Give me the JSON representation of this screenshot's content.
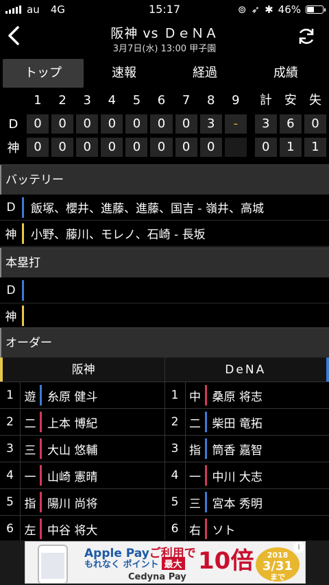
{
  "status_bar": {
    "carrier": "au",
    "network": "4G",
    "time": "15:17",
    "battery": "46%",
    "battery_level": 0.46
  },
  "header": {
    "title": "阪神 vs ＤｅＮＡ",
    "subtitle": "3月7日(水) 13:00 甲子園"
  },
  "tabs": [
    {
      "label": "トップ",
      "active": true
    },
    {
      "label": "速報",
      "active": false
    },
    {
      "label": "経過",
      "active": false
    },
    {
      "label": "成績",
      "active": false
    }
  ],
  "scoreboard": {
    "innings": [
      "1",
      "2",
      "3",
      "4",
      "5",
      "6",
      "7",
      "8",
      "9"
    ],
    "totals_headers": [
      "計",
      "安",
      "失"
    ],
    "teams": [
      {
        "label": "D",
        "innings": [
          "0",
          "0",
          "0",
          "0",
          "0",
          "0",
          "0",
          "3",
          "-"
        ],
        "totals": [
          "3",
          "6",
          "0"
        ]
      },
      {
        "label": "神",
        "innings": [
          "0",
          "0",
          "0",
          "0",
          "0",
          "0",
          "0",
          "0",
          ""
        ],
        "totals": [
          "0",
          "1",
          "1"
        ]
      }
    ]
  },
  "battery_section": {
    "title": "バッテリー",
    "rows": [
      {
        "team": "D",
        "text": "飯塚、櫻井、進藤、進藤、国吉 - 嶺井、高城",
        "color": "#3d7bd4"
      },
      {
        "team": "神",
        "text": "小野、藤川、モレノ、石崎 - 長坂",
        "color": "#e8c84a"
      }
    ]
  },
  "homerun_section": {
    "title": "本塁打",
    "rows": [
      {
        "team": "D",
        "text": "",
        "color": "#3d7bd4"
      },
      {
        "team": "神",
        "text": "",
        "color": "#e8c84a"
      }
    ]
  },
  "order_section": {
    "title": "オーダー",
    "home_team": "阪神",
    "away_team": "DeNA",
    "rows": [
      {
        "num": "1",
        "home_pos": "遊",
        "home_name": "糸原 健斗",
        "home_color": "#3d7bd4",
        "away_pos": "中",
        "away_name": "桑原 将志",
        "away_color": "#d03b5a"
      },
      {
        "num": "2",
        "home_pos": "二",
        "home_name": "上本 博紀",
        "home_color": "#d03b5a",
        "away_pos": "二",
        "away_name": "柴田 竜拓",
        "away_color": "#3d7bd4"
      },
      {
        "num": "3",
        "home_pos": "三",
        "home_name": "大山 悠輔",
        "home_color": "#d03b5a",
        "away_pos": "指",
        "away_name": "筒香 嘉智",
        "away_color": "#3d7bd4"
      },
      {
        "num": "4",
        "home_pos": "一",
        "home_name": "山崎 憲晴",
        "home_color": "#d03b5a",
        "away_pos": "一",
        "away_name": "中川 大志",
        "away_color": "#d03b5a"
      },
      {
        "num": "5",
        "home_pos": "指",
        "home_name": "陽川 尚将",
        "home_color": "#d03b5a",
        "away_pos": "三",
        "away_name": "宮本 秀明",
        "away_color": "#3d7bd4"
      },
      {
        "num": "6",
        "home_pos": "左",
        "home_name": "中谷 将大",
        "home_color": "#d03b5a",
        "away_pos": "右",
        "away_name": "ソト",
        "away_color": "#d03b5a"
      }
    ]
  },
  "ad": {
    "line1_a": "Apple Pay",
    "line1_b": "ご利用で",
    "line2_a": "もれなく ポイント",
    "line2_badge": "最大",
    "big": "10倍",
    "logos": "Cedyna  Pay",
    "date_year": "2018",
    "date": "3/31",
    "date_suffix": "まで"
  },
  "colors": {
    "dena_blue": "#3d7bd4",
    "tigers_yellow": "#e8c84a",
    "player_red": "#d03b5a",
    "dash_orange": "#e7a43a"
  }
}
